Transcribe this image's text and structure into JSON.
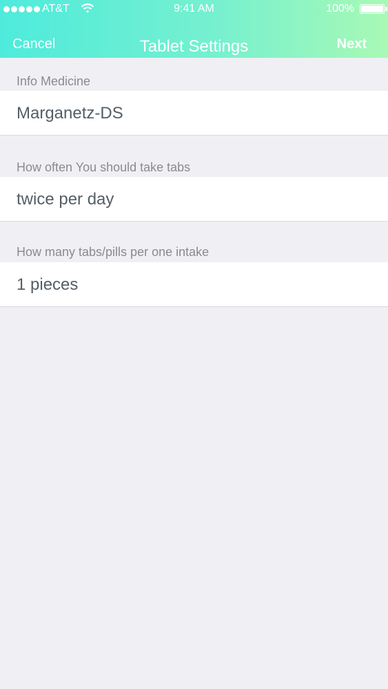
{
  "status_bar": {
    "carrier": "AT&T",
    "wifi_icon": "wifi-icon",
    "time": "9:41 AM",
    "battery_percent": "100%",
    "battery_level": 1.0
  },
  "nav": {
    "cancel_label": "Cancel",
    "title": "Tablet Settings",
    "next_label": "Next"
  },
  "form": {
    "sections": [
      {
        "label": "Info Medicine",
        "value": "Marganetz-DS"
      },
      {
        "label": "How often You should take tabs",
        "value": "twice per day"
      },
      {
        "label": "How many tabs/pills per one intake",
        "value": "1 pieces"
      }
    ]
  },
  "colors": {
    "header_gradient_start": "#4eebdc",
    "header_gradient_end": "#a8f9b5",
    "background": "#efeff4",
    "label_text": "#8a8a8f",
    "value_text": "#545e66"
  }
}
